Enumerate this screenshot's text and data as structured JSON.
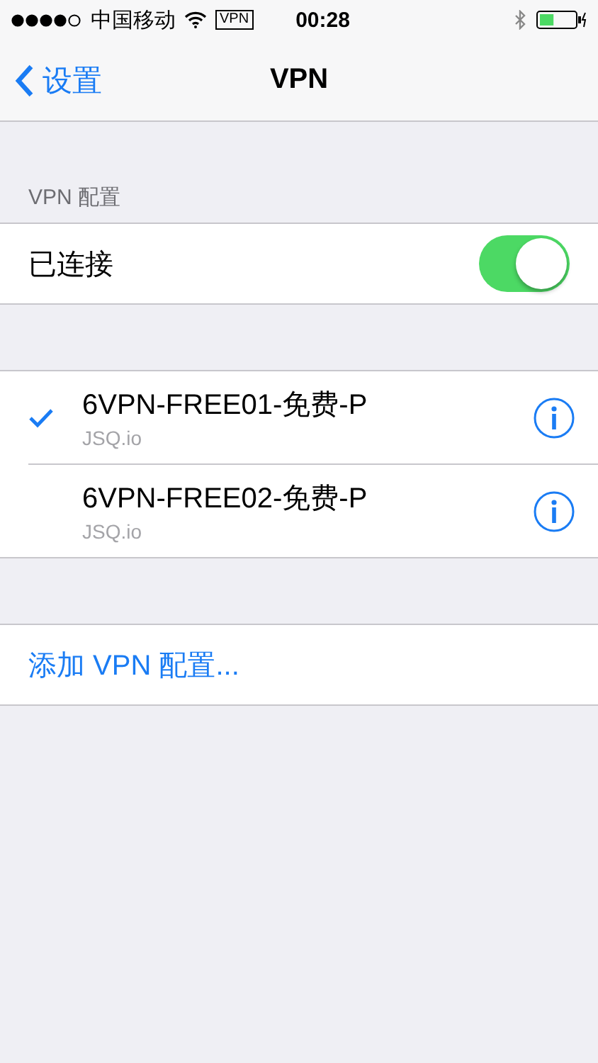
{
  "status_bar": {
    "carrier": "中国移动",
    "vpn_badge": "VPN",
    "time": "00:28"
  },
  "nav": {
    "back": "设置",
    "title": "VPN"
  },
  "status_section": {
    "header": "VPN 配置",
    "label": "已连接",
    "on": true
  },
  "configs": [
    {
      "name": "6VPN-FREE01-免费-P",
      "server": "JSQ.io",
      "selected": true
    },
    {
      "name": "6VPN-FREE02-免费-P",
      "server": "JSQ.io",
      "selected": false
    }
  ],
  "add_link": "添加 VPN 配置..."
}
